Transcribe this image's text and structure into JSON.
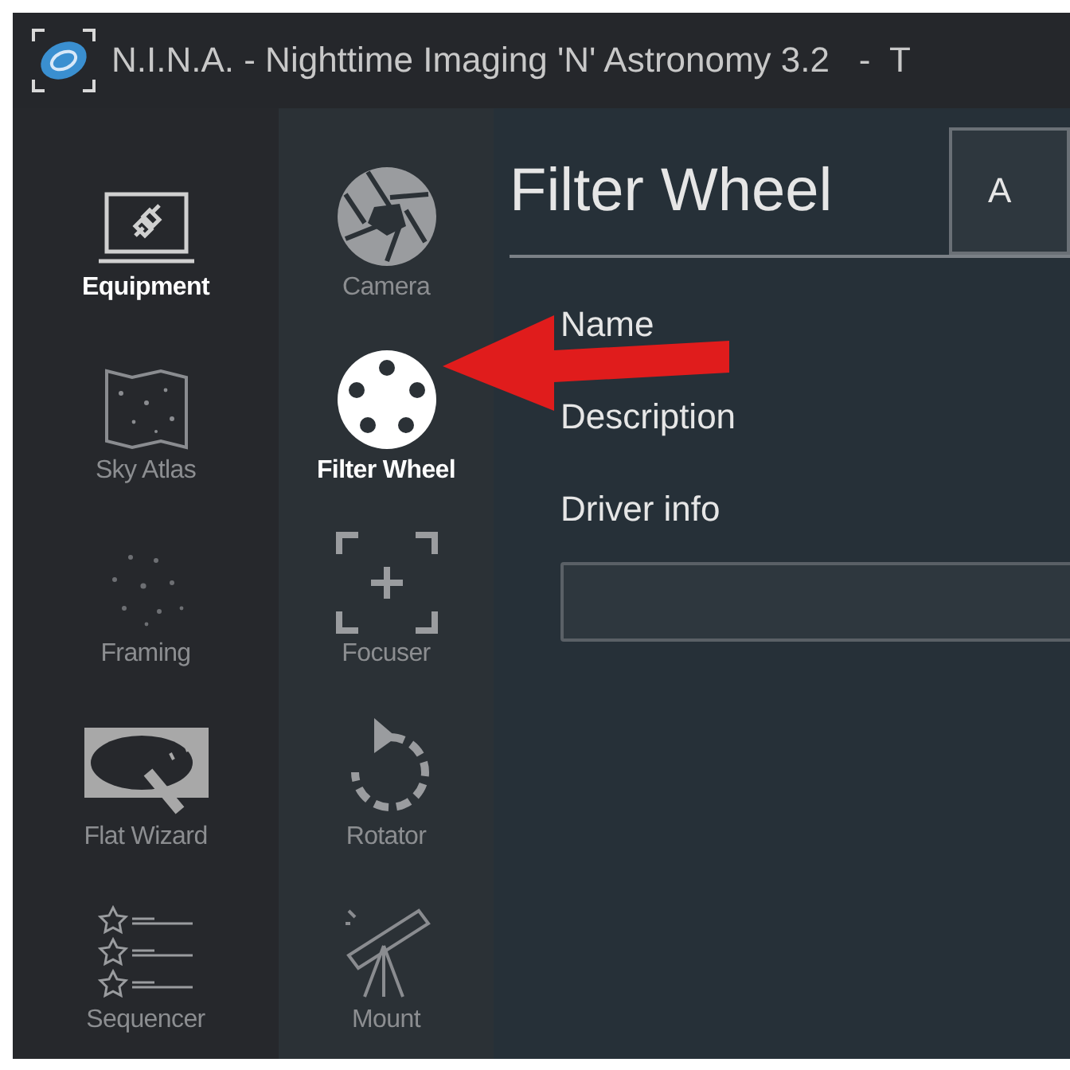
{
  "window": {
    "title": "N.I.N.A. - Nighttime Imaging 'N' Astronomy 3.2   -  T"
  },
  "sidebar": {
    "items": [
      {
        "label": "Equipment",
        "selected": true
      },
      {
        "label": "Sky Atlas",
        "selected": false
      },
      {
        "label": "Framing",
        "selected": false
      },
      {
        "label": "Flat Wizard",
        "selected": false
      },
      {
        "label": "Sequencer",
        "selected": false
      }
    ]
  },
  "equipment_nav": {
    "items": [
      {
        "label": "Camera",
        "selected": false
      },
      {
        "label": "Filter Wheel",
        "selected": true
      },
      {
        "label": "Focuser",
        "selected": false
      },
      {
        "label": "Rotator",
        "selected": false
      },
      {
        "label": "Mount",
        "selected": false
      }
    ]
  },
  "panel": {
    "title": "Filter Wheel",
    "device_button": "A",
    "fields": [
      {
        "label": "Name"
      },
      {
        "label": "Description"
      },
      {
        "label": "Driver info"
      }
    ]
  },
  "overlays": [
    {
      "kind": "arrow"
    }
  ]
}
